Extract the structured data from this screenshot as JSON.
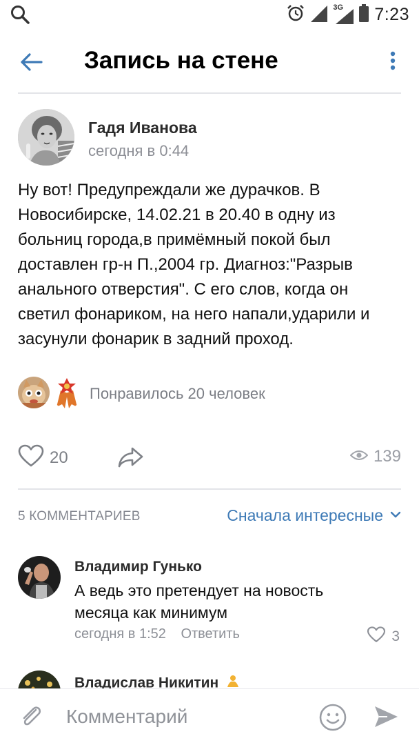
{
  "status_bar": {
    "time": "7:23",
    "network": "3G"
  },
  "header": {
    "title": "Запись на стене"
  },
  "post": {
    "author": "Гадя Иванова",
    "time": "сегодня в 0:44",
    "text_lines": [
      "Ну вот! Предупреждали же дурачков. В",
      "Новосибирске, 14.02.21 в 20.40 в одну из",
      "больниц города,в примёмный покой  был",
      "доставлен  гр-н П.,2004 гр. Диагноз:\"Разрыв",
      "анального отверстия\". С его слов, когда он",
      "светил фонариком, на него напали,ударили и",
      "засунули фонарик в задний проход."
    ],
    "likes_text": "Понравилось 20 человек",
    "like_count": "20",
    "views": "139"
  },
  "comments": {
    "count_label": "5 КОММЕНТАРИЕВ",
    "sort_label": "Сначала интересные",
    "items": [
      {
        "author": "Владимир Гунько",
        "text_lines": [
          "А ведь это претендует на новость",
          "месяца как минимум"
        ],
        "time": "сегодня в 1:52",
        "reply": "Ответить",
        "likes": "3"
      },
      {
        "author": "Владислав Никитин"
      }
    ]
  },
  "comment_bar": {
    "placeholder": "Комментарий"
  },
  "colors": {
    "accent": "#3e7ab6",
    "divider": "#e3e4e8",
    "secondary_text": "#8d8f96"
  }
}
